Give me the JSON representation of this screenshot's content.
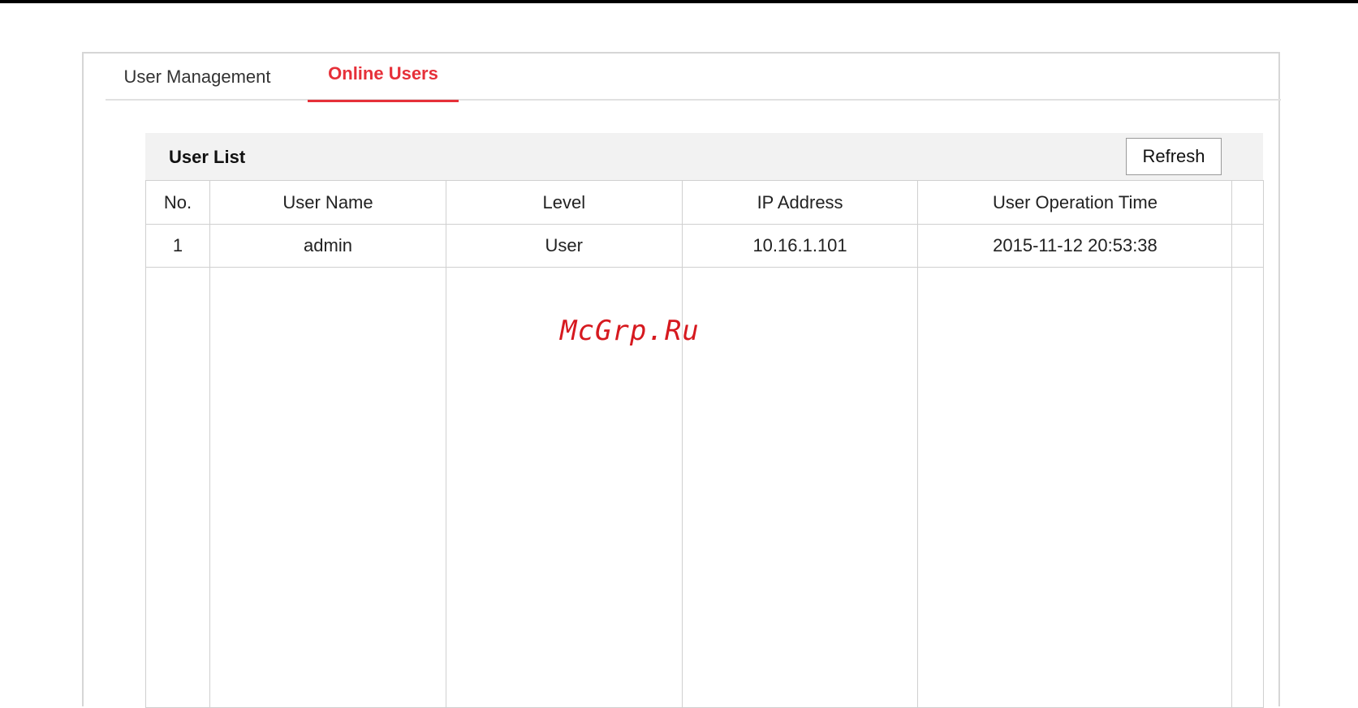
{
  "tabs": [
    {
      "label": "User Management",
      "active": false
    },
    {
      "label": "Online Users",
      "active": true
    }
  ],
  "user_list": {
    "title": "User List",
    "refresh_label": "Refresh",
    "columns": [
      "No.",
      "User Name",
      "Level",
      "IP Address",
      "User Operation Time"
    ],
    "rows": [
      {
        "no": "1",
        "user_name": "admin",
        "level": "User",
        "ip_address": "10.16.1.101",
        "operation_time": "2015-11-12 20:53:38"
      }
    ]
  },
  "watermark": "McGrp.Ru",
  "colors": {
    "accent": "#e63039",
    "header_bg": "#f2f2f2",
    "border": "#d0d0d0",
    "watermark": "#d6191f"
  }
}
